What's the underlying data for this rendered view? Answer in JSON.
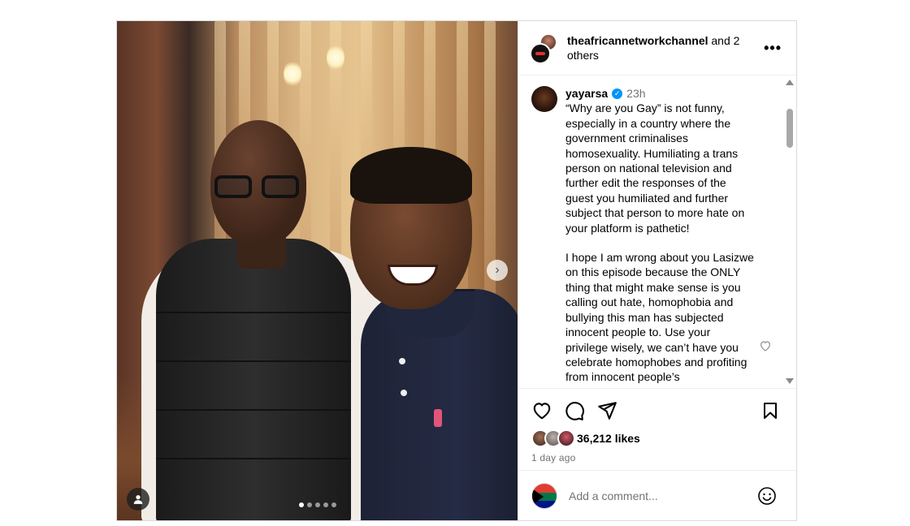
{
  "header": {
    "username": "theafricannetworkchannel",
    "suffix": " and 2 others",
    "more_icon": "more-horizontal-icon"
  },
  "caption": {
    "username": "yayarsa",
    "verified": true,
    "time": "23h",
    "paragraphs": [
      "“Why are you Gay” is not funny, especially in a country where the government criminalises homosexuality. Humiliating a trans person on national television and further edit the responses of the guest you humiliated and further subject that person to more hate on your platform is pathetic!",
      "I hope I am wrong about you Lasizwe on this episode because the ONLY thing that might make sense is you calling out hate, homophobia and bullying this man has subjected innocent people to. Use your privilege wisely, we can’t have you celebrate homophobes and profiting from innocent people’s"
    ]
  },
  "media": {
    "slide_count": 5,
    "active_slide": 1,
    "next_icon": "chevron-right-icon",
    "tag_icon": "user-tag-icon"
  },
  "actions": {
    "like_icon": "heart-icon",
    "comment_icon": "comment-icon",
    "share_icon": "share-icon",
    "save_icon": "bookmark-icon"
  },
  "likes": {
    "count_text": "36,212 likes"
  },
  "post_date": "1 day ago",
  "comment": {
    "placeholder": "Add a comment...",
    "emoji_icon": "emoji-icon"
  },
  "colors": {
    "verified": "#0095f6",
    "secondary_text": "#737373",
    "border": "#dbdbdb"
  }
}
